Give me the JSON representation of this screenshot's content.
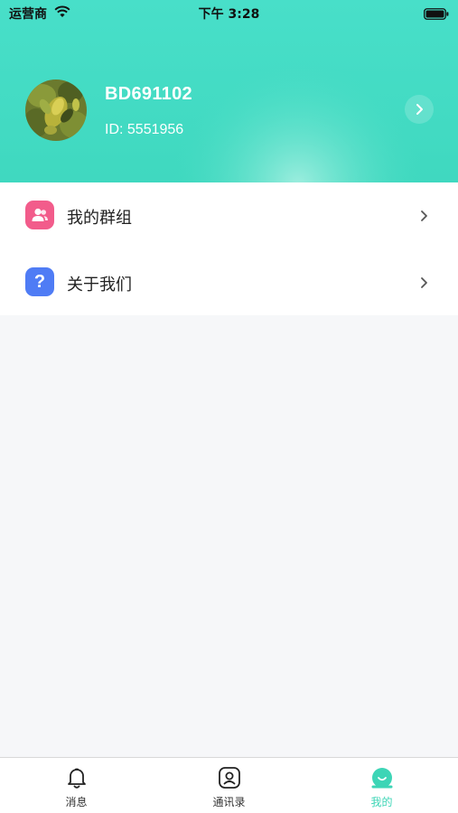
{
  "status_bar": {
    "carrier": "运营商",
    "time": "下午 3:28"
  },
  "profile": {
    "name": "BD691102",
    "id_text": "ID: 5551956"
  },
  "menu": {
    "items": [
      {
        "label": "我的群组",
        "icon": "group-icon",
        "icon_color": "#f25c8b"
      },
      {
        "label": "关于我们",
        "icon": "question-icon",
        "icon_color": "#4f7cf5",
        "glyph": "?"
      }
    ]
  },
  "tabbar": {
    "tabs": [
      {
        "label": "消息",
        "icon": "bell-icon",
        "active": false
      },
      {
        "label": "通讯录",
        "icon": "contacts-icon",
        "active": false
      },
      {
        "label": "我的",
        "icon": "profile-icon",
        "active": true
      }
    ]
  },
  "colors": {
    "accent": "#3dd5b6",
    "header_teal": "#41dcc2",
    "background": "#f6f7f9"
  }
}
